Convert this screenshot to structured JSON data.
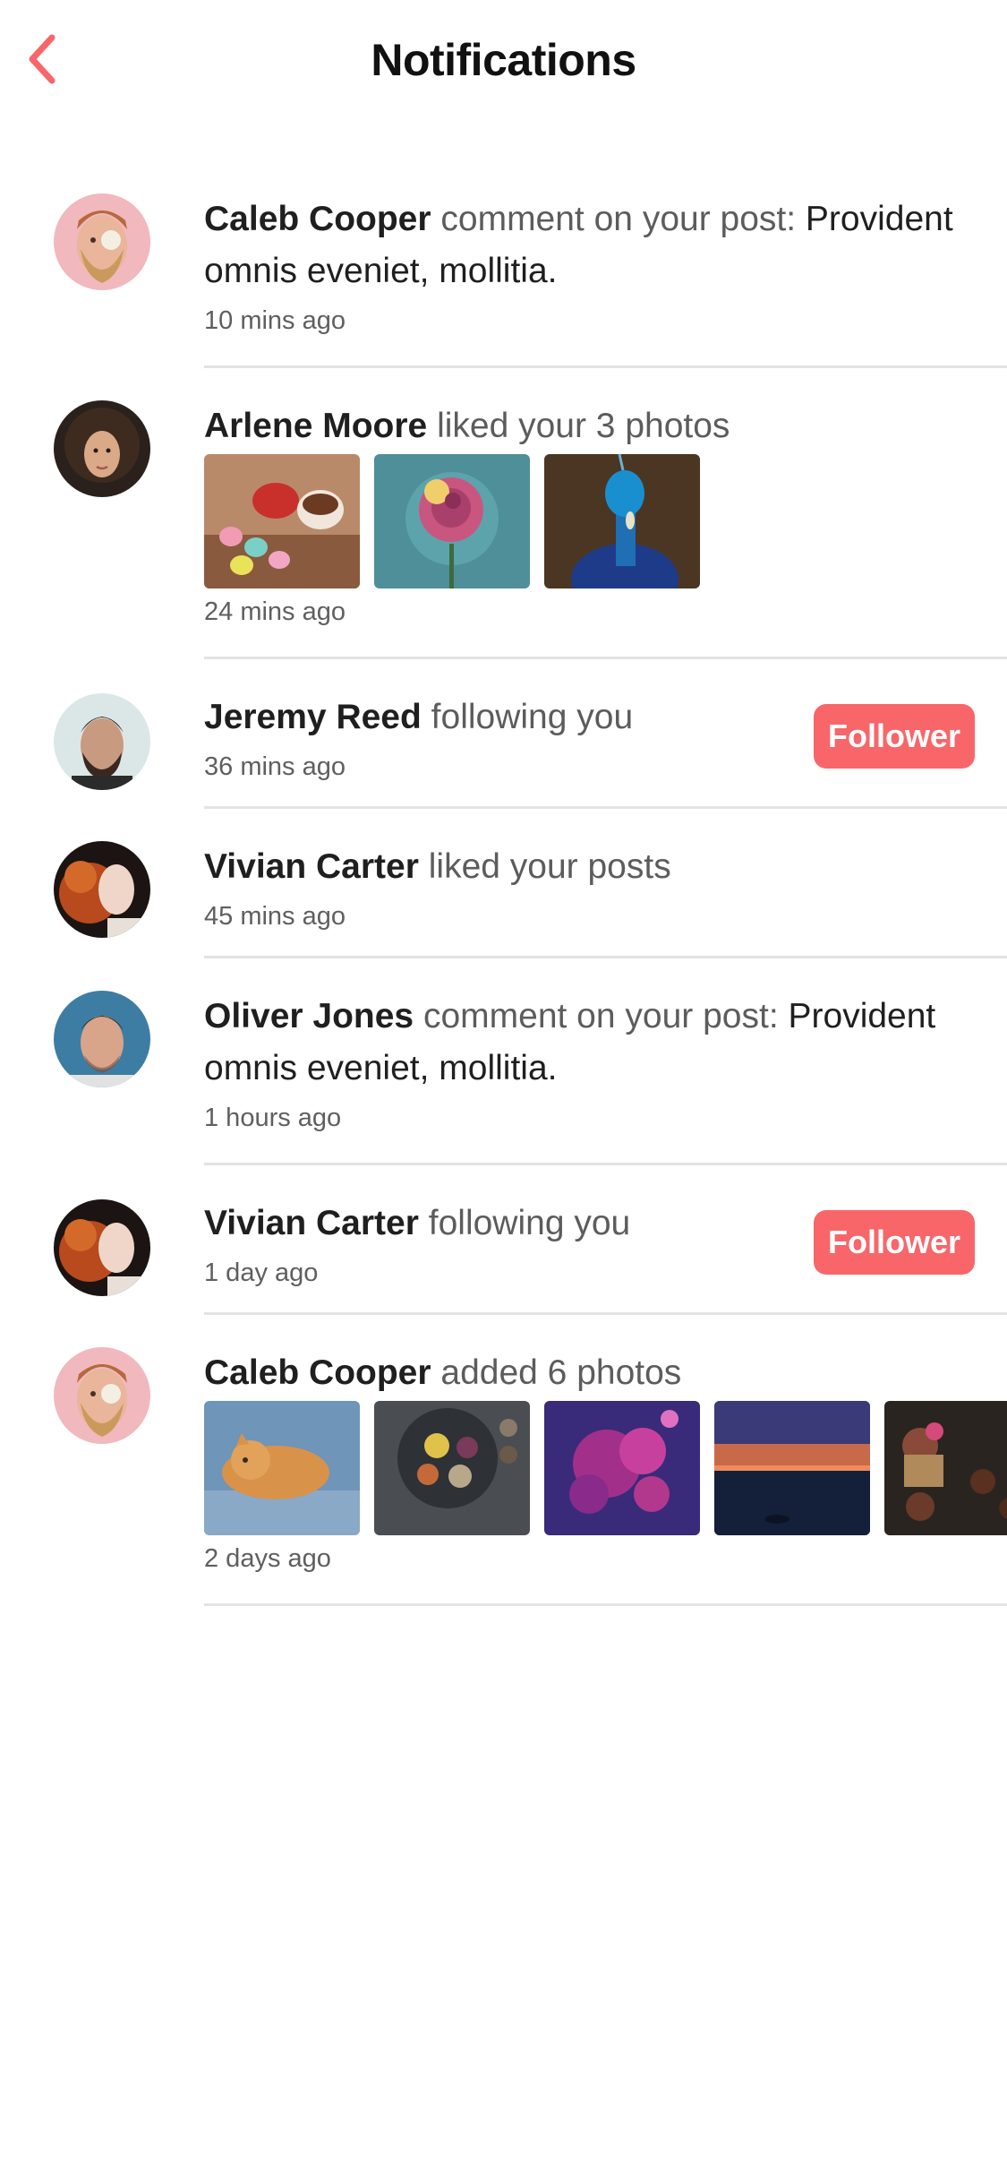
{
  "header": {
    "title": "Notifications",
    "back_icon": "chevron-left-icon",
    "accent_color": "#f86669"
  },
  "notifications": [
    {
      "user": "Caleb Cooper",
      "action": "comment on your post:",
      "comment": "Provident omnis eveniet, mollitia.",
      "time": "10 mins ago"
    },
    {
      "user": "Arlene Moore",
      "action": "liked your 3 photos",
      "time": "24 mins ago"
    },
    {
      "user": "Jeremy Reed",
      "action": "following you",
      "time": "36 mins ago",
      "button": "Follower"
    },
    {
      "user": "Vivian Carter",
      "action": "liked your posts",
      "time": "45 mins ago"
    },
    {
      "user": "Oliver Jones",
      "action": "comment on your post:",
      "comment": "Provident omnis eveniet, mollitia.",
      "time": "1 hours ago"
    },
    {
      "user": "Vivian Carter",
      "action": "following you",
      "time": "1 day ago",
      "button": "Follower"
    },
    {
      "user": "Caleb Cooper",
      "action": "added 6 photos",
      "time": "2 days ago"
    }
  ]
}
